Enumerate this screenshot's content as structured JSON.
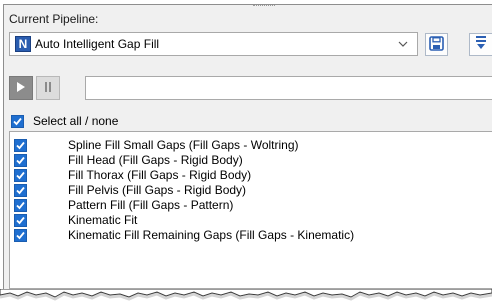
{
  "pipeline": {
    "title": "Current Pipeline:",
    "selected": "Auto Intelligent Gap Fill",
    "logo_letter": "N"
  },
  "toolbar": {
    "play_icon": "play-icon",
    "pause_icon": "pause-icon",
    "save_icon": "floppy-disk-icon",
    "filter_icon": "filter-icon"
  },
  "select_all": {
    "label": "Select all / none",
    "checked": true
  },
  "operations": [
    {
      "label": "Spline Fill Small Gaps (Fill Gaps - Woltring)",
      "checked": true
    },
    {
      "label": "Fill Head (Fill Gaps - Rigid Body)",
      "checked": true
    },
    {
      "label": "Fill Thorax (Fill Gaps - Rigid Body)",
      "checked": true
    },
    {
      "label": "Fill Pelvis (Fill Gaps - Rigid Body)",
      "checked": true
    },
    {
      "label": "Pattern Fill (Fill Gaps - Pattern)",
      "checked": true
    },
    {
      "label": "Kinematic Fit",
      "checked": true
    },
    {
      "label": "Kinematic Fill Remaining Gaps (Fill Gaps - Kinematic)",
      "checked": true
    }
  ],
  "colors": {
    "panel_bg": "#f0f0f0",
    "checkbox": "#1f6fd0",
    "accent_blue": "#2a5db0"
  }
}
